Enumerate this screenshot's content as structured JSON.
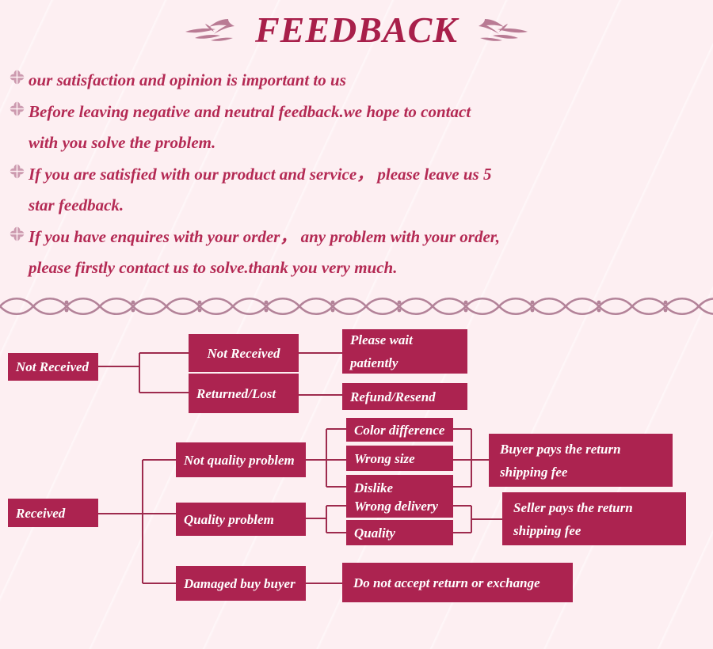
{
  "header": {
    "title": "FEEDBACK",
    "ornament_left": "leaf-branch-ornament",
    "ornament_right": "leaf-branch-ornament"
  },
  "colors": {
    "background": "#fdeff2",
    "accent": "#ac2350",
    "text": "#b42a54",
    "title": "#a81f4a",
    "bullet": "#cc9aaf",
    "connector": "#9e2b4e",
    "node_text": "#ffffff"
  },
  "bullets": [
    {
      "icon": "flower-bullet-icon",
      "lines": [
        "our satisfaction and opinion is important to us"
      ]
    },
    {
      "icon": "flower-bullet-icon",
      "lines": [
        "Before leaving negative and neutral feedback.we hope to contact",
        "with you solve the problem."
      ]
    },
    {
      "icon": "flower-bullet-icon",
      "lines": [
        "If you are satisfied with our product and service，  please leave us 5",
        "star feedback."
      ]
    },
    {
      "icon": "flower-bullet-icon",
      "lines": [
        "If you have enquires with your order，  any problem with your order,",
        "please firstly contact us to solve.thank you very much."
      ]
    }
  ],
  "divider": {
    "icon": "wavy-ribbon-divider"
  },
  "flowchart": {
    "nodes": [
      {
        "id": "not-received-root",
        "label": "Not Received"
      },
      {
        "id": "not-received-child",
        "label": "Not Received"
      },
      {
        "id": "returned-lost",
        "label": "Returned/Lost"
      },
      {
        "id": "please-wait-patiently",
        "label": "Please wait\npatiently"
      },
      {
        "id": "refund-resend",
        "label": "Refund/Resend"
      },
      {
        "id": "received-root",
        "label": "Received"
      },
      {
        "id": "not-quality-problem",
        "label": "Not quality problem"
      },
      {
        "id": "color-difference",
        "label": "Color difference"
      },
      {
        "id": "wrong-size",
        "label": "Wrong size"
      },
      {
        "id": "dislike",
        "label": "Dislike"
      },
      {
        "id": "buyer-pays-return",
        "label": "Buyer pays the return\nshipping fee"
      },
      {
        "id": "quality-problem",
        "label": "Quality problem"
      },
      {
        "id": "wrong-delivery",
        "label": "Wrong delivery"
      },
      {
        "id": "quality",
        "label": "Quality"
      },
      {
        "id": "seller-pays-return",
        "label": "Seller pays the return\nshipping fee"
      },
      {
        "id": "damaged-buy-buyer",
        "label": "Damaged buy buyer"
      },
      {
        "id": "do-not-accept",
        "label": "Do not accept return or exchange"
      }
    ]
  }
}
